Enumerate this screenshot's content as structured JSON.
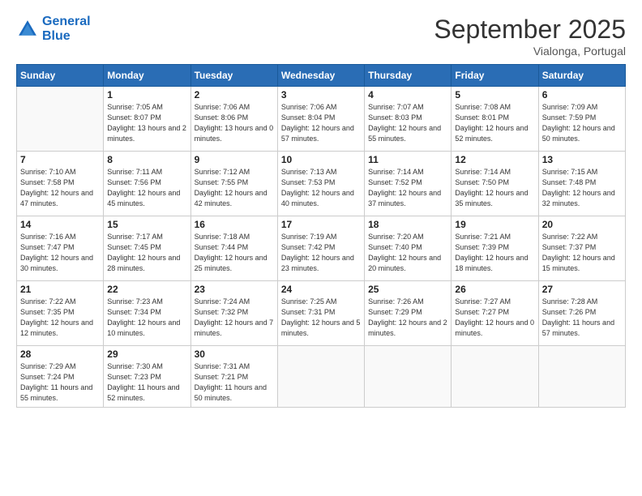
{
  "logo": {
    "line1": "General",
    "line2": "Blue"
  },
  "title": "September 2025",
  "subtitle": "Vialonga, Portugal",
  "days_header": [
    "Sunday",
    "Monday",
    "Tuesday",
    "Wednesday",
    "Thursday",
    "Friday",
    "Saturday"
  ],
  "weeks": [
    [
      {
        "num": "",
        "sunrise": "",
        "sunset": "",
        "daylight": ""
      },
      {
        "num": "1",
        "sunrise": "Sunrise: 7:05 AM",
        "sunset": "Sunset: 8:07 PM",
        "daylight": "Daylight: 13 hours and 2 minutes."
      },
      {
        "num": "2",
        "sunrise": "Sunrise: 7:06 AM",
        "sunset": "Sunset: 8:06 PM",
        "daylight": "Daylight: 13 hours and 0 minutes."
      },
      {
        "num": "3",
        "sunrise": "Sunrise: 7:06 AM",
        "sunset": "Sunset: 8:04 PM",
        "daylight": "Daylight: 12 hours and 57 minutes."
      },
      {
        "num": "4",
        "sunrise": "Sunrise: 7:07 AM",
        "sunset": "Sunset: 8:03 PM",
        "daylight": "Daylight: 12 hours and 55 minutes."
      },
      {
        "num": "5",
        "sunrise": "Sunrise: 7:08 AM",
        "sunset": "Sunset: 8:01 PM",
        "daylight": "Daylight: 12 hours and 52 minutes."
      },
      {
        "num": "6",
        "sunrise": "Sunrise: 7:09 AM",
        "sunset": "Sunset: 7:59 PM",
        "daylight": "Daylight: 12 hours and 50 minutes."
      }
    ],
    [
      {
        "num": "7",
        "sunrise": "Sunrise: 7:10 AM",
        "sunset": "Sunset: 7:58 PM",
        "daylight": "Daylight: 12 hours and 47 minutes."
      },
      {
        "num": "8",
        "sunrise": "Sunrise: 7:11 AM",
        "sunset": "Sunset: 7:56 PM",
        "daylight": "Daylight: 12 hours and 45 minutes."
      },
      {
        "num": "9",
        "sunrise": "Sunrise: 7:12 AM",
        "sunset": "Sunset: 7:55 PM",
        "daylight": "Daylight: 12 hours and 42 minutes."
      },
      {
        "num": "10",
        "sunrise": "Sunrise: 7:13 AM",
        "sunset": "Sunset: 7:53 PM",
        "daylight": "Daylight: 12 hours and 40 minutes."
      },
      {
        "num": "11",
        "sunrise": "Sunrise: 7:14 AM",
        "sunset": "Sunset: 7:52 PM",
        "daylight": "Daylight: 12 hours and 37 minutes."
      },
      {
        "num": "12",
        "sunrise": "Sunrise: 7:14 AM",
        "sunset": "Sunset: 7:50 PM",
        "daylight": "Daylight: 12 hours and 35 minutes."
      },
      {
        "num": "13",
        "sunrise": "Sunrise: 7:15 AM",
        "sunset": "Sunset: 7:48 PM",
        "daylight": "Daylight: 12 hours and 32 minutes."
      }
    ],
    [
      {
        "num": "14",
        "sunrise": "Sunrise: 7:16 AM",
        "sunset": "Sunset: 7:47 PM",
        "daylight": "Daylight: 12 hours and 30 minutes."
      },
      {
        "num": "15",
        "sunrise": "Sunrise: 7:17 AM",
        "sunset": "Sunset: 7:45 PM",
        "daylight": "Daylight: 12 hours and 28 minutes."
      },
      {
        "num": "16",
        "sunrise": "Sunrise: 7:18 AM",
        "sunset": "Sunset: 7:44 PM",
        "daylight": "Daylight: 12 hours and 25 minutes."
      },
      {
        "num": "17",
        "sunrise": "Sunrise: 7:19 AM",
        "sunset": "Sunset: 7:42 PM",
        "daylight": "Daylight: 12 hours and 23 minutes."
      },
      {
        "num": "18",
        "sunrise": "Sunrise: 7:20 AM",
        "sunset": "Sunset: 7:40 PM",
        "daylight": "Daylight: 12 hours and 20 minutes."
      },
      {
        "num": "19",
        "sunrise": "Sunrise: 7:21 AM",
        "sunset": "Sunset: 7:39 PM",
        "daylight": "Daylight: 12 hours and 18 minutes."
      },
      {
        "num": "20",
        "sunrise": "Sunrise: 7:22 AM",
        "sunset": "Sunset: 7:37 PM",
        "daylight": "Daylight: 12 hours and 15 minutes."
      }
    ],
    [
      {
        "num": "21",
        "sunrise": "Sunrise: 7:22 AM",
        "sunset": "Sunset: 7:35 PM",
        "daylight": "Daylight: 12 hours and 12 minutes."
      },
      {
        "num": "22",
        "sunrise": "Sunrise: 7:23 AM",
        "sunset": "Sunset: 7:34 PM",
        "daylight": "Daylight: 12 hours and 10 minutes."
      },
      {
        "num": "23",
        "sunrise": "Sunrise: 7:24 AM",
        "sunset": "Sunset: 7:32 PM",
        "daylight": "Daylight: 12 hours and 7 minutes."
      },
      {
        "num": "24",
        "sunrise": "Sunrise: 7:25 AM",
        "sunset": "Sunset: 7:31 PM",
        "daylight": "Daylight: 12 hours and 5 minutes."
      },
      {
        "num": "25",
        "sunrise": "Sunrise: 7:26 AM",
        "sunset": "Sunset: 7:29 PM",
        "daylight": "Daylight: 12 hours and 2 minutes."
      },
      {
        "num": "26",
        "sunrise": "Sunrise: 7:27 AM",
        "sunset": "Sunset: 7:27 PM",
        "daylight": "Daylight: 12 hours and 0 minutes."
      },
      {
        "num": "27",
        "sunrise": "Sunrise: 7:28 AM",
        "sunset": "Sunset: 7:26 PM",
        "daylight": "Daylight: 11 hours and 57 minutes."
      }
    ],
    [
      {
        "num": "28",
        "sunrise": "Sunrise: 7:29 AM",
        "sunset": "Sunset: 7:24 PM",
        "daylight": "Daylight: 11 hours and 55 minutes."
      },
      {
        "num": "29",
        "sunrise": "Sunrise: 7:30 AM",
        "sunset": "Sunset: 7:23 PM",
        "daylight": "Daylight: 11 hours and 52 minutes."
      },
      {
        "num": "30",
        "sunrise": "Sunrise: 7:31 AM",
        "sunset": "Sunset: 7:21 PM",
        "daylight": "Daylight: 11 hours and 50 minutes."
      },
      {
        "num": "",
        "sunrise": "",
        "sunset": "",
        "daylight": ""
      },
      {
        "num": "",
        "sunrise": "",
        "sunset": "",
        "daylight": ""
      },
      {
        "num": "",
        "sunrise": "",
        "sunset": "",
        "daylight": ""
      },
      {
        "num": "",
        "sunrise": "",
        "sunset": "",
        "daylight": ""
      }
    ]
  ]
}
